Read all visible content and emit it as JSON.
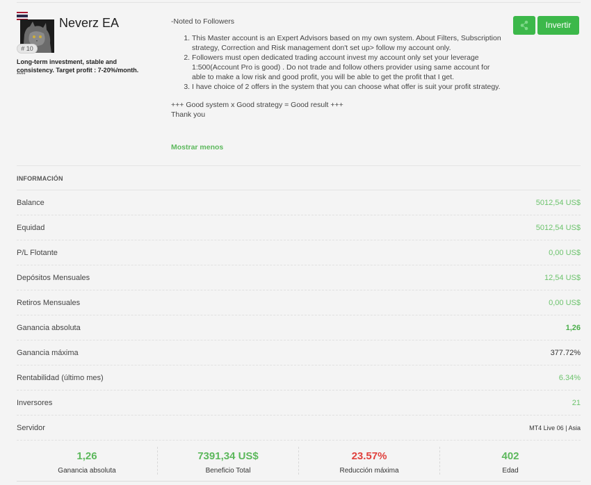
{
  "profile": {
    "name": "Neverz EA",
    "rank": "# 10",
    "tagline": "Long-term investment, stable and consistency. Target profit : 7-20%/month.",
    "stars": "****",
    "flag_colors": [
      "#a51931",
      "#f4f5f8",
      "#2d2a4a",
      "#f4f5f8",
      "#a51931"
    ]
  },
  "description": {
    "intro": "-Noted to Followers",
    "items": [
      "This Master account is an Expert Advisors based on my own system. About Filters, Subscription strategy, Correction and Risk management don't set up> follow my account only.",
      "Followers must open dedicated trading account invest my account only set your leverage 1:500(Account Pro is good) . Do not trade and follow others provider using same account for able to make a low risk and good profit, you will be able to get the profit that I get.",
      "I have choice of 2 offers in the system that you can choose what offer is suit your profit strategy."
    ],
    "outro_1": "+++ Good system x Good strategy = Good result +++",
    "outro_2": "Thank you",
    "toggle_label": "Mostrar menos"
  },
  "actions": {
    "invest_label": "Invertir",
    "share_icon": "share-icon",
    "accent": "#3cb84a"
  },
  "info": {
    "title": "INFORMACIÓN",
    "rows": [
      {
        "label": "Balance",
        "value": "5012,54 US$"
      },
      {
        "label": "Equidad",
        "value": "5012,54 US$"
      },
      {
        "label": "P/L Flotante",
        "value": "0,00 US$"
      },
      {
        "label": "Depósitos Mensuales",
        "value": "12,54 US$"
      },
      {
        "label": "Retiros Mensuales",
        "value": "0,00 US$"
      },
      {
        "label": "Ganancia absoluta",
        "value": "1,26"
      },
      {
        "label": "Ganancia máxima",
        "value": "377.72%"
      },
      {
        "label": "Rentabilidad (último mes)",
        "value": "6.34%"
      },
      {
        "label": "Inversores",
        "value": "21"
      },
      {
        "label": "Servidor",
        "value": "MT4 Live 06 | Asia"
      }
    ]
  },
  "stats": [
    {
      "value": "1,26",
      "caption": "Ganancia absoluta"
    },
    {
      "value": "7391,34 US$",
      "caption": "Beneficio Total"
    },
    {
      "value": "23.57%",
      "caption": "Reducción máxima"
    },
    {
      "value": "402",
      "caption": "Edad"
    }
  ]
}
